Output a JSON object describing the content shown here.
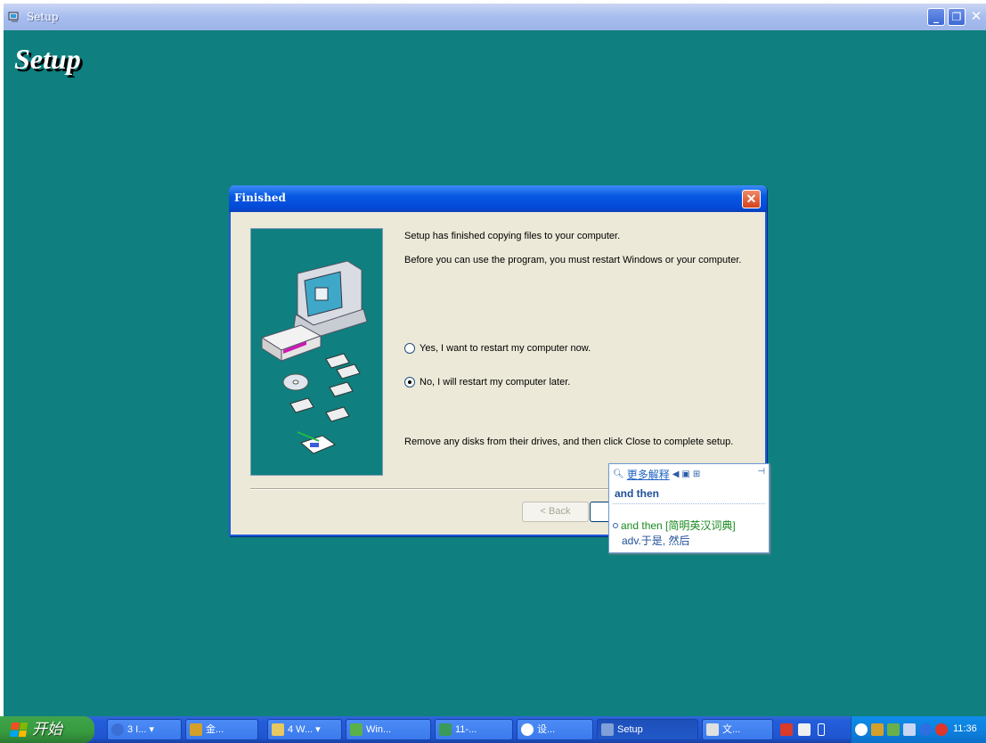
{
  "window": {
    "title": "Setup",
    "heading": "Setup",
    "controls": {
      "minimize": "_",
      "restore": "❐",
      "close": "✕"
    }
  },
  "dialog": {
    "title": "Finished",
    "close_glyph": "✕",
    "message_1": "Setup has finished copying files to your computer.",
    "message_2": "Before you can use the program, you must restart Windows or your computer.",
    "options": [
      {
        "label": "Yes, I want to restart my computer now.",
        "selected": false
      },
      {
        "label": "No, I will restart my computer later.",
        "selected": true
      }
    ],
    "message_3": "Remove any disks from their drives, and then click Close to complete setup.",
    "back_label": "< Back"
  },
  "dictionary_popup": {
    "more_label": "更多解释",
    "word": "and then",
    "entry": "and then [简明英汉词典]",
    "definition": "adv.于是, 然后"
  },
  "taskbar": {
    "start_label": "开始",
    "items": [
      {
        "label": "3 I...",
        "color": "#3b6fd6",
        "active": false
      },
      {
        "label": "金...",
        "color": "#d4a02a",
        "active": false
      },
      {
        "label": "4 W...",
        "color": "#e8c860",
        "active": false
      },
      {
        "label": "Win...",
        "color": "#5ab04a",
        "active": false
      },
      {
        "label": "11-...",
        "color": "#3a9a5a",
        "active": false
      },
      {
        "label": "设...",
        "color": "#ffffff",
        "active": false
      },
      {
        "label": "Setup",
        "color": "#7fa0d8",
        "active": true
      },
      {
        "label": "文...",
        "color": "#e0e0e0",
        "active": false
      }
    ],
    "clock": "11:36"
  },
  "colors": {
    "desktop_teal": "#0f7f7f",
    "dialog_blue": "#0a52d9",
    "dict_green": "#178a1e"
  }
}
